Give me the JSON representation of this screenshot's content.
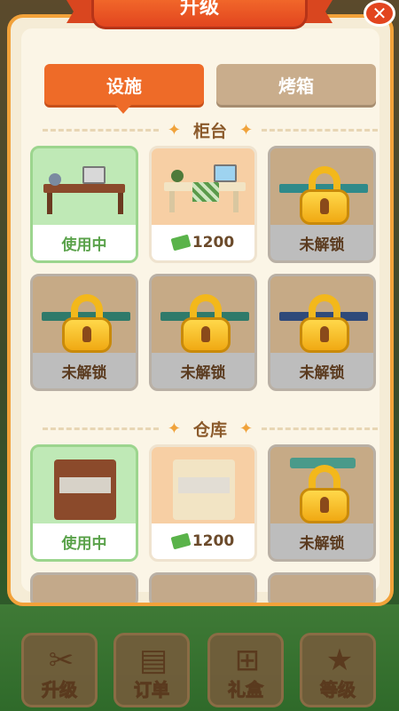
{
  "header": {
    "title": "升级"
  },
  "tabs": [
    {
      "label": "设施",
      "active": true
    },
    {
      "label": "烤箱",
      "active": false
    }
  ],
  "sections": [
    {
      "title": "柜台",
      "items": [
        {
          "status": "in_use",
          "label": "使用中"
        },
        {
          "status": "price",
          "label": "1200"
        },
        {
          "status": "locked",
          "label": "未解锁"
        },
        {
          "status": "locked",
          "label": "未解锁"
        },
        {
          "status": "locked",
          "label": "未解锁"
        },
        {
          "status": "locked",
          "label": "未解锁"
        }
      ]
    },
    {
      "title": "仓库",
      "items": [
        {
          "status": "in_use",
          "label": "使用中"
        },
        {
          "status": "price",
          "label": "1200"
        },
        {
          "status": "locked",
          "label": "未解锁"
        }
      ]
    }
  ],
  "bottom_nav": [
    {
      "label": "升级",
      "icon": "tools-icon"
    },
    {
      "label": "订单",
      "icon": "order-icon"
    },
    {
      "label": "礼盒",
      "icon": "gift-icon"
    },
    {
      "label": "等级",
      "icon": "level-icon"
    }
  ],
  "colors": {
    "accent": "#ee6b28",
    "panel_border": "#f2a23a",
    "in_use": "#5aa24a",
    "locked_foot": "#bdbdbd"
  }
}
